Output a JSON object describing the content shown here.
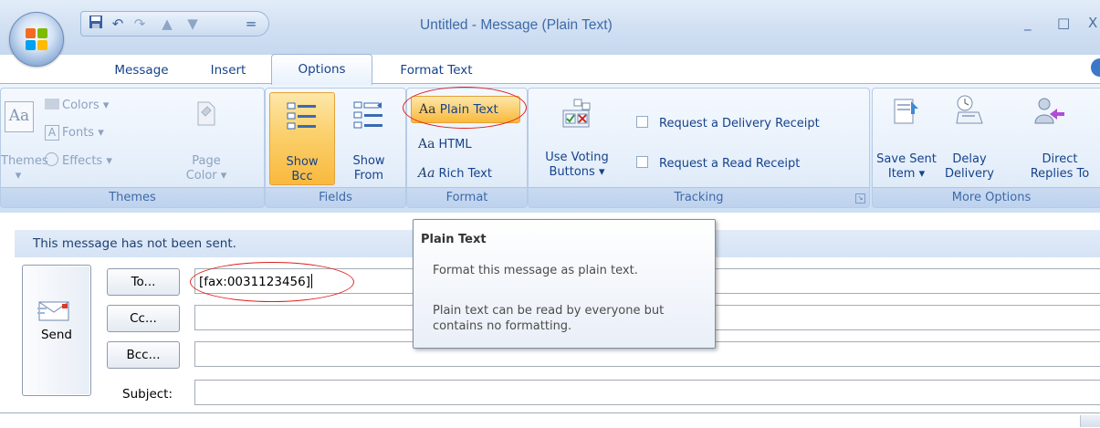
{
  "window": {
    "title": "Untitled - Message (Plain Text)",
    "minimize_glyph": "_",
    "maximize_glyph": "□",
    "close_glyph": "X"
  },
  "quick_access": {
    "icons": [
      "save-icon",
      "undo-icon",
      "redo-icon",
      "previous-item-icon",
      "next-item-icon",
      "customize-dropdown-icon"
    ],
    "customize_glyph": "="
  },
  "tabs": [
    {
      "label": "Message",
      "active": false
    },
    {
      "label": "Insert",
      "active": false
    },
    {
      "label": "Options",
      "active": true
    },
    {
      "label": "Format Text",
      "active": false
    }
  ],
  "ribbon": {
    "themes_group": {
      "label": "Themes",
      "themes_button": "Themes",
      "themes_icon_text": "Aa",
      "colors": "Colors",
      "fonts": "Fonts",
      "effects": "Effects",
      "fonts_icon_text": "A",
      "page_color_line1": "Page",
      "page_color_line2": "Color"
    },
    "fields_group": {
      "label": "Fields",
      "show_bcc_line1": "Show",
      "show_bcc_line2": "Bcc",
      "show_from_line1": "Show",
      "show_from_line2": "From"
    },
    "format_group": {
      "label": "Format",
      "icon_text": "Aa",
      "plain_text": "Plain Text",
      "html": "HTML",
      "rich_text": "Rich Text",
      "selected": "Plain Text"
    },
    "tracking_group": {
      "label": "Tracking",
      "voting_line1": "Use Voting",
      "voting_line2": "Buttons",
      "delivery_receipt": "Request a Delivery Receipt",
      "read_receipt": "Request a Read Receipt"
    },
    "more_options_group": {
      "label": "More Options",
      "save_sent_line1": "Save Sent",
      "save_sent_line2": "Item",
      "delay_line1": "Delay",
      "delay_line2": "Delivery",
      "direct_line1": "Direct",
      "direct_line2": "Replies To"
    }
  },
  "infobar": {
    "text": "This message has not been sent."
  },
  "compose": {
    "send_label": "Send",
    "to_button": "To...",
    "cc_button": "Cc...",
    "bcc_button": "Bcc...",
    "subject_label": "Subject:",
    "to_value": "[fax:0031123456]",
    "cc_value": "",
    "bcc_value": "",
    "subject_value": ""
  },
  "tooltip": {
    "title": "Plain Text",
    "line1": "Format this message as plain text.",
    "line2": "Plain text can be read by everyone but contains no formatting."
  },
  "colors": {
    "accent": "#15428b",
    "ribbon_bg": "#dde9f8",
    "active_button": "#f9c25c",
    "highlight": "#e0201c"
  }
}
